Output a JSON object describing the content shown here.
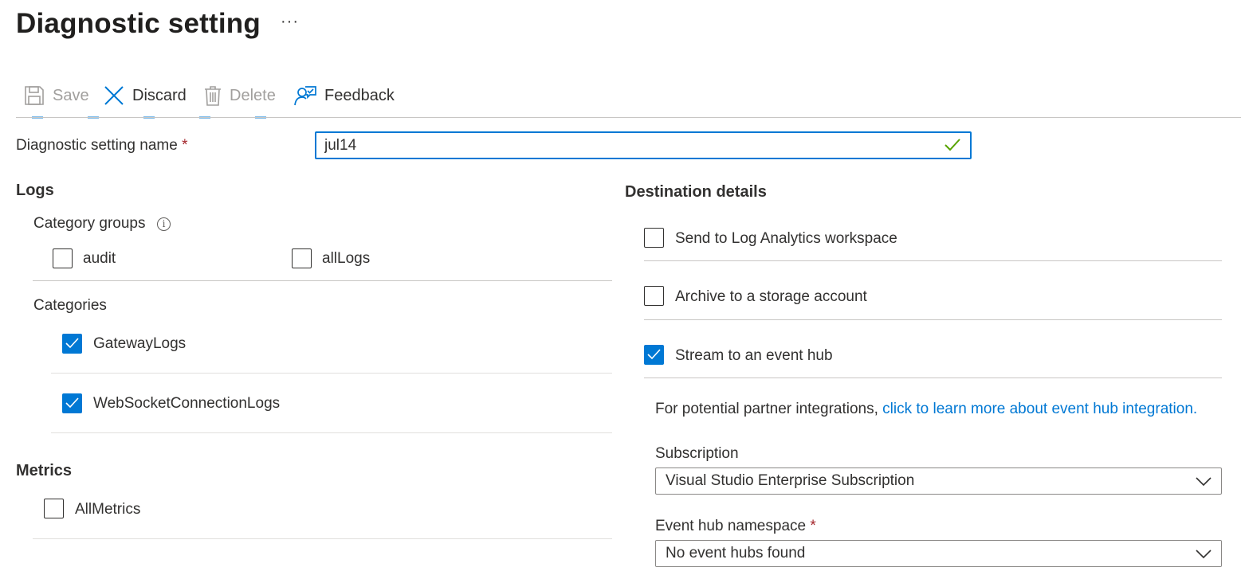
{
  "page": {
    "title": "Diagnostic setting",
    "more_label": "···"
  },
  "toolbar": {
    "save_label": "Save",
    "discard_label": "Discard",
    "delete_label": "Delete",
    "feedback_label": "Feedback"
  },
  "form": {
    "name_label": "Diagnostic setting name",
    "required_mark": "*",
    "name_value": "jul14"
  },
  "logs": {
    "heading": "Logs",
    "category_groups_label": "Category groups",
    "info_glyph": "i",
    "groups": [
      {
        "label": "audit",
        "checked": false
      },
      {
        "label": "allLogs",
        "checked": false
      }
    ],
    "categories_label": "Categories",
    "categories": [
      {
        "label": "GatewayLogs",
        "checked": true
      },
      {
        "label": "WebSocketConnectionLogs",
        "checked": true
      }
    ]
  },
  "metrics": {
    "heading": "Metrics",
    "items": [
      {
        "label": "AllMetrics",
        "checked": false
      }
    ]
  },
  "destination": {
    "heading": "Destination details",
    "options": [
      {
        "label": "Send to Log Analytics workspace",
        "checked": false
      },
      {
        "label": "Archive to a storage account",
        "checked": false
      },
      {
        "label": "Stream to an event hub",
        "checked": true
      }
    ],
    "partner_text": "For potential partner integrations,",
    "partner_link": "click to learn more about event hub integration.",
    "subscription_label": "Subscription",
    "subscription_value": "Visual Studio Enterprise Subscription",
    "namespace_label": "Event hub namespace",
    "namespace_required": "*",
    "namespace_value": "No event hubs found"
  },
  "colors": {
    "accent": "#0078d4",
    "required": "#a4262c",
    "valid": "#57a300",
    "disabled_text": "#a19f9d"
  },
  "icons": {
    "save": "save-icon",
    "discard": "close-icon",
    "delete": "trash-icon",
    "feedback": "feedback-icon",
    "valid": "checkmark-icon",
    "info": "info-icon",
    "dropdown": "chevron-down-icon"
  }
}
